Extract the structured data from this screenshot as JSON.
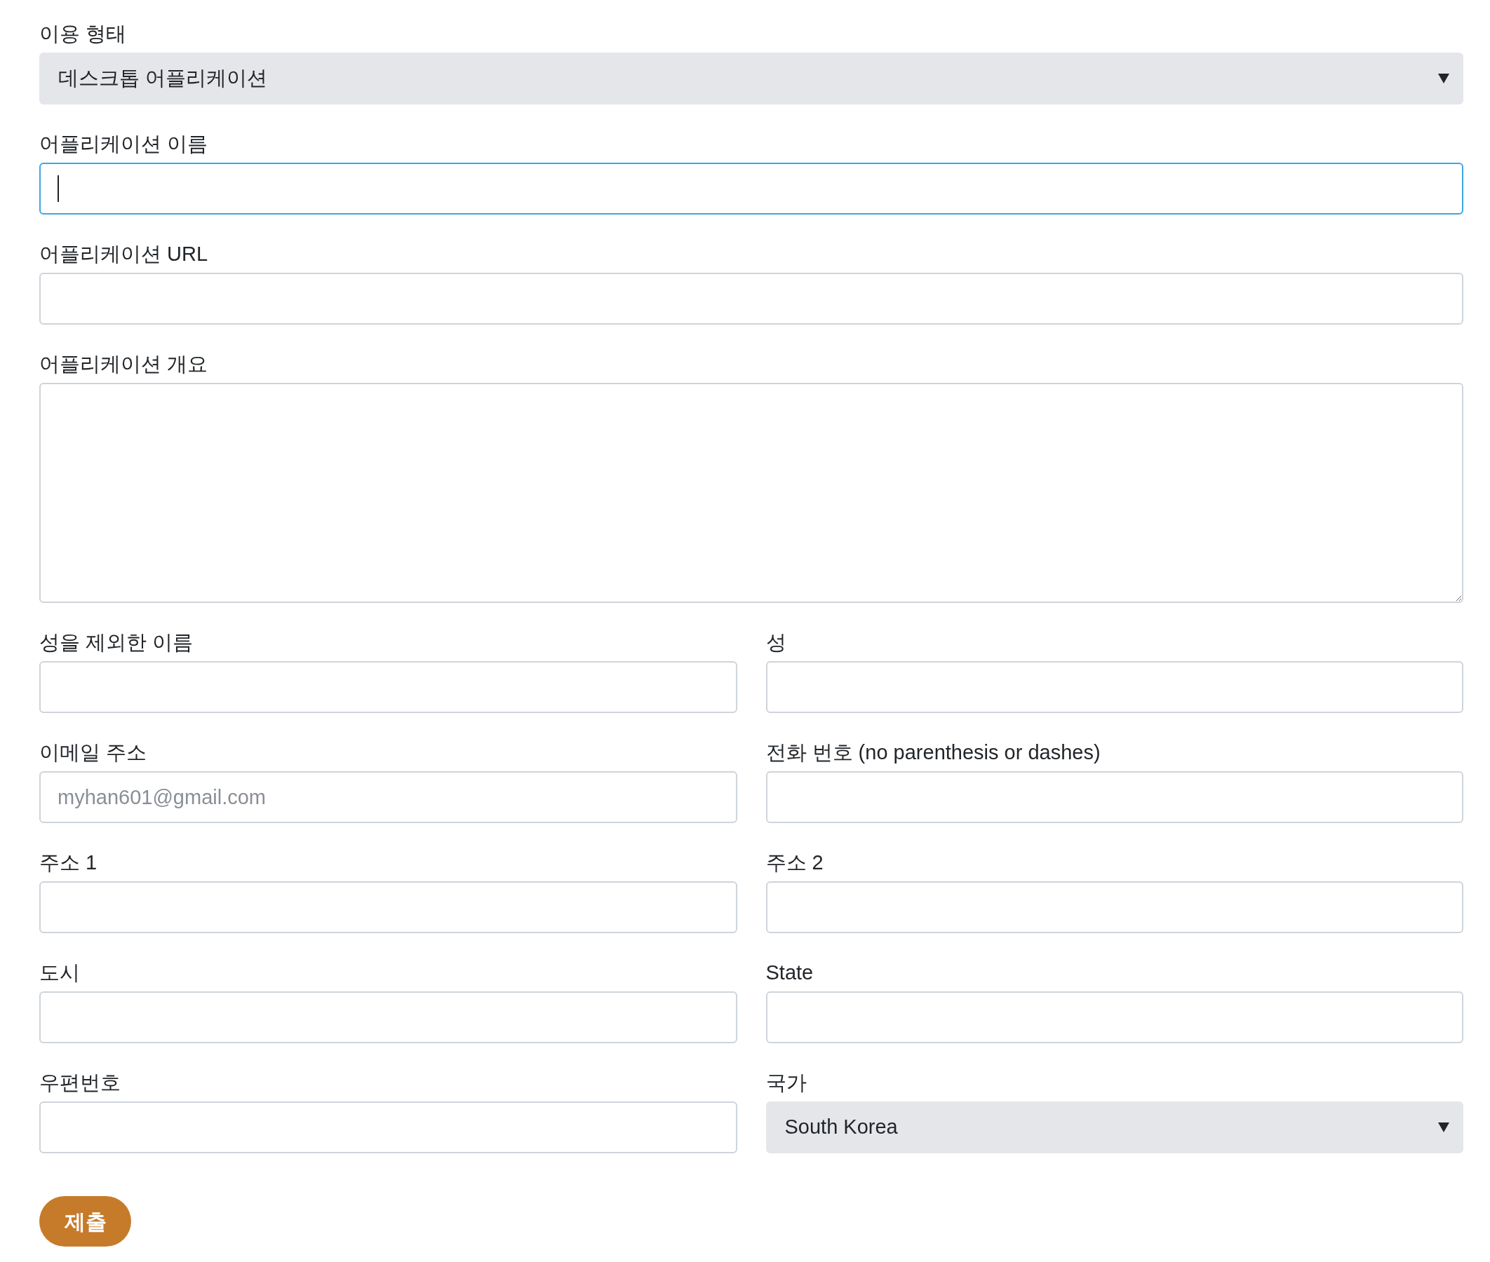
{
  "rows": [
    [
      {
        "kind": "select",
        "label": "이용 형태",
        "value": "데스크톱 어플리케이션",
        "focused": false
      }
    ],
    [
      {
        "kind": "text",
        "label": "어플리케이션 이름",
        "focused": true
      }
    ],
    [
      {
        "kind": "text",
        "label": "어플리케이션 URL",
        "focused": false
      }
    ],
    [
      {
        "kind": "textarea",
        "label": "어플리케이션 개요",
        "focused": false
      }
    ],
    [
      {
        "kind": "text",
        "label": "성을 제외한 이름",
        "focused": false
      },
      {
        "kind": "text",
        "label": "성",
        "focused": false
      }
    ],
    [
      {
        "kind": "text",
        "label": "이메일 주소",
        "placeholder": "myhan601@gmail.com",
        "focused": false
      },
      {
        "kind": "text",
        "label": "전화 번호 (no parenthesis or dashes)",
        "focused": false
      }
    ],
    [
      {
        "kind": "text",
        "label": "주소 1",
        "focused": false
      },
      {
        "kind": "text",
        "label": "주소 2",
        "focused": false
      }
    ],
    [
      {
        "kind": "text",
        "label": "도시",
        "focused": false
      },
      {
        "kind": "text",
        "label": "State",
        "focused": false
      }
    ],
    [
      {
        "kind": "text",
        "label": "우편번호",
        "focused": false
      },
      {
        "kind": "select",
        "label": "국가",
        "value": "South Korea",
        "focused": false
      }
    ]
  ],
  "submit": "제출"
}
